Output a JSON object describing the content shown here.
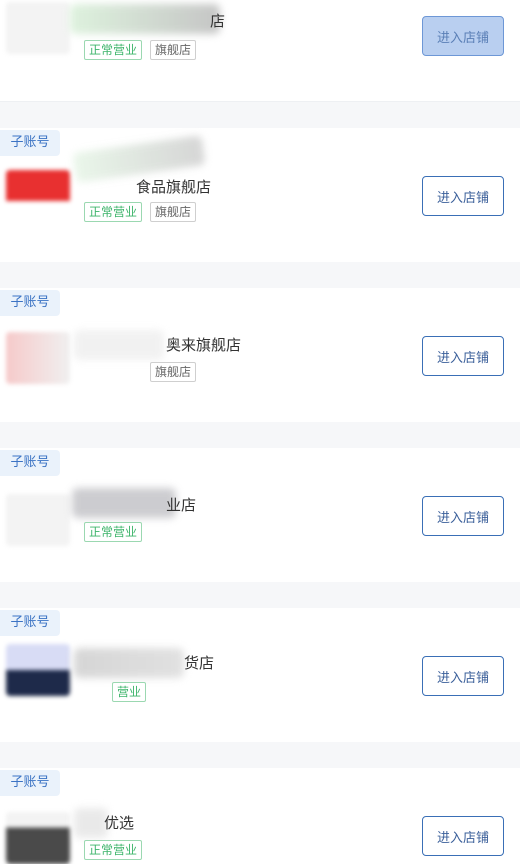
{
  "badge_label": "子账号",
  "enter_button_label": "进入店铺",
  "stores": [
    {
      "name_visible": "店",
      "show_badge": false,
      "tags": [
        "正常营业",
        "旗舰店"
      ]
    },
    {
      "name_visible": "食品旗舰店",
      "show_badge": true,
      "tags": [
        "正常营业",
        "旗舰店"
      ]
    },
    {
      "name_visible": "奥来旗舰店",
      "show_badge": true,
      "tags": [
        "旗舰店"
      ]
    },
    {
      "name_visible": "业店",
      "show_badge": true,
      "tags": [
        "正常营业"
      ]
    },
    {
      "name_visible": "货店",
      "show_badge": true,
      "tags": [
        "营业"
      ]
    },
    {
      "name_visible": "优选",
      "show_badge": true,
      "tags": [
        "正常营业"
      ]
    }
  ]
}
